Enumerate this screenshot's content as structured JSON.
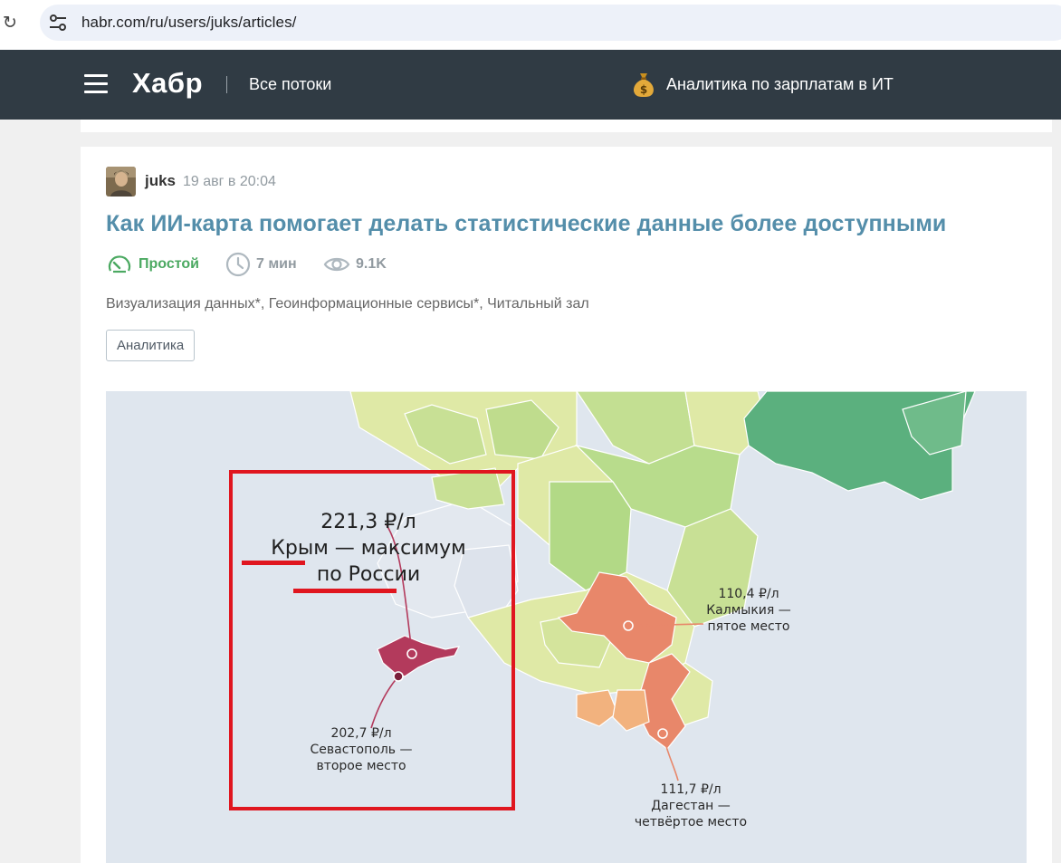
{
  "browser": {
    "url": "habr.com/ru/users/juks/articles/"
  },
  "header": {
    "logo": "Хабр",
    "flows": "Все потоки",
    "salary_link": "Аналитика по зарплатам в ИТ"
  },
  "article": {
    "author": "juks",
    "date": "19 авг в 20:04",
    "title": "Как ИИ-карта помогает делать статистические данные более доступными",
    "complexity": "Простой",
    "reading_time": "7 мин",
    "views": "9.1K",
    "hubs": [
      "Визуализация данных*",
      "Геоинформационные сервисы*",
      "Читальный зал"
    ],
    "tag": "Аналитика"
  },
  "map": {
    "callout": {
      "line1": "221,3 ₽/л",
      "line2": "Крым — максимум",
      "line3": "по России"
    },
    "labels": {
      "sevastopol": [
        "202,7 ₽/л",
        "Севастополь —",
        "второе место"
      ],
      "kalmykia": [
        "110,4 ₽/л",
        "Калмыкия —",
        "пятое место"
      ],
      "dagestan": [
        "111,7 ₽/л",
        "Дагестан —",
        "четвёртое место"
      ]
    },
    "colors": {
      "sea": "#dfe6ee",
      "crimea": "#b33a5c",
      "high": "#e8876a",
      "mid": "#f2b27e",
      "light_green": "#dfe9a6",
      "green": "#b8dc8c",
      "dark_green": "#5bb07e",
      "neighbor_gray": "#e3e8ef",
      "highlight_box": "#e0161f"
    }
  }
}
